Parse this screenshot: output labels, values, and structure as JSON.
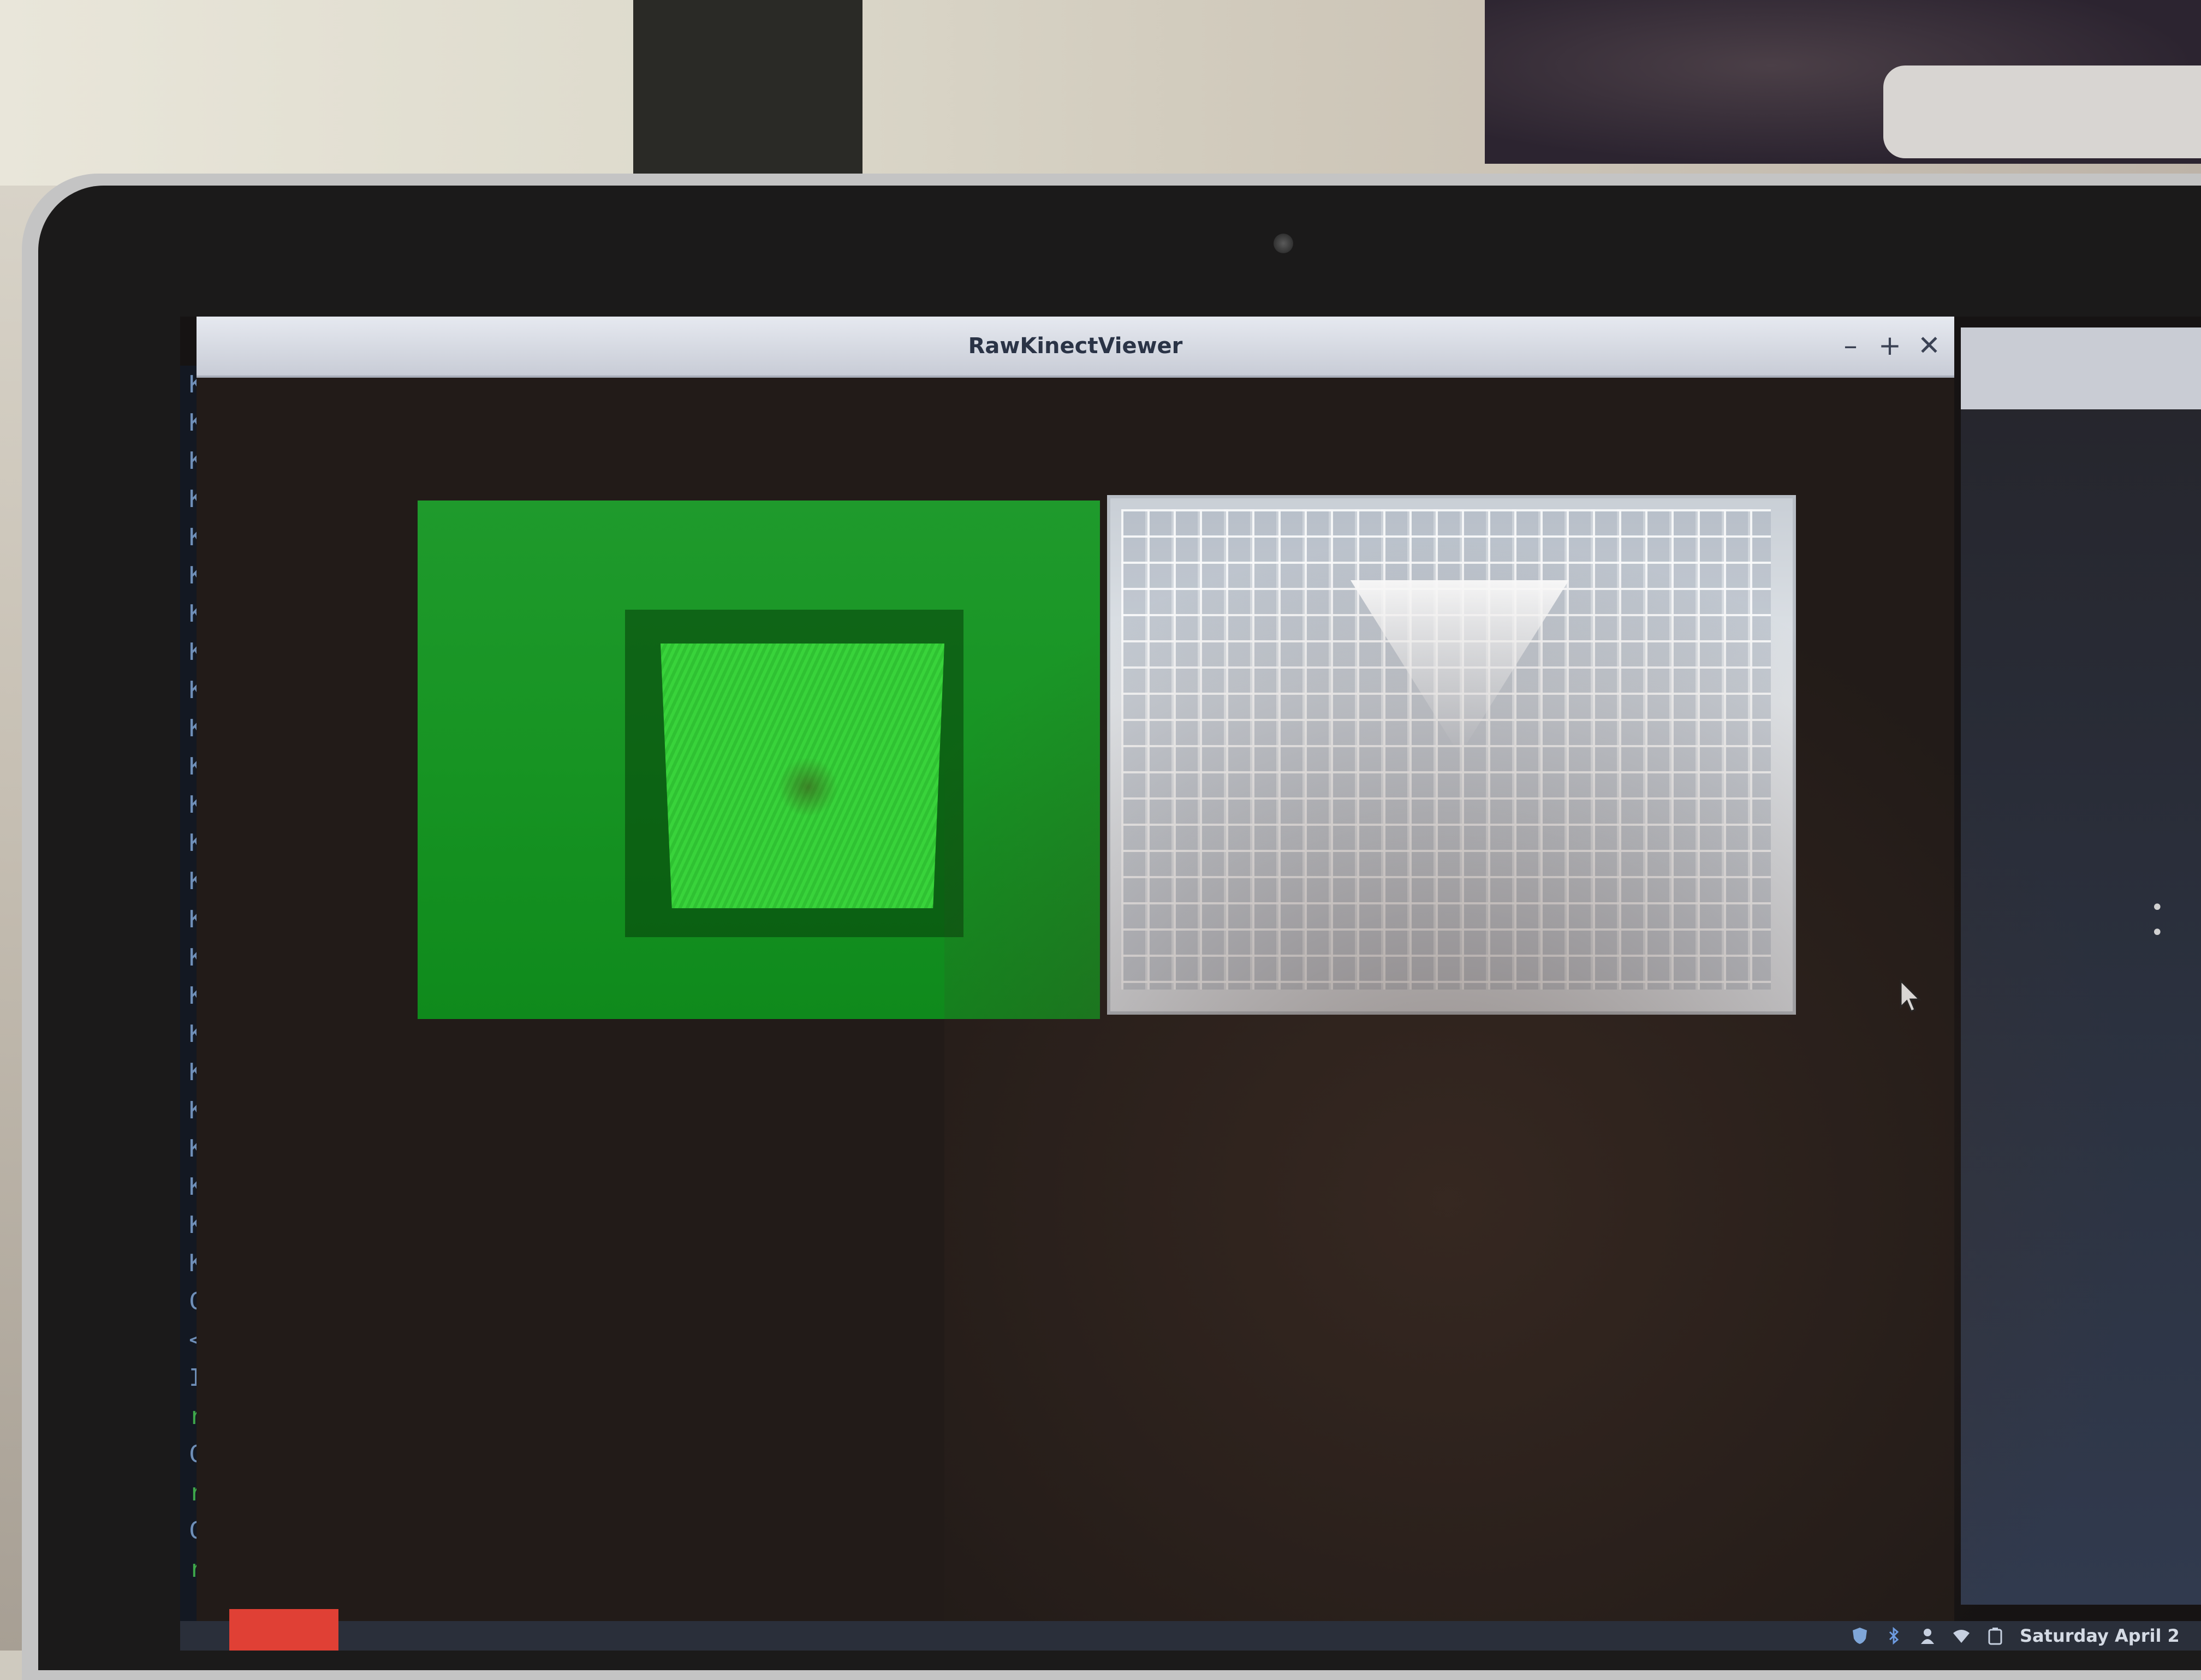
{
  "window": {
    "title": "RawKinectViewer",
    "minimize_symbol": "–",
    "maximize_symbol": "+",
    "close_symbol": "✕"
  },
  "views": {
    "depth": {
      "icon": "depth-stream-view",
      "color": "#1f9a2c"
    },
    "video": {
      "icon": "color-stream-view",
      "color": "#e4e8ec"
    }
  },
  "terminal": {
    "glyphs": [
      "K",
      "K",
      "K",
      "K",
      "K",
      "K",
      "K",
      "K",
      "K",
      "K",
      "K",
      "K",
      "K",
      "K",
      "K",
      "K",
      "K",
      "K",
      "K",
      "K",
      "K",
      "K",
      "K",
      "K",
      "C",
      "<",
      "I",
      "r",
      "C",
      "r",
      "C",
      "r"
    ]
  },
  "taskbar": {
    "accent": "#e04035",
    "tray": {
      "shield": "shield-icon",
      "bluetooth": "bluetooth-icon",
      "user": "user-icon",
      "wifi": "wifi-icon",
      "battery": "battery-icon",
      "date": "Saturday April 2"
    }
  },
  "cursor": {
    "icon": "mouse-pointer-icon"
  }
}
